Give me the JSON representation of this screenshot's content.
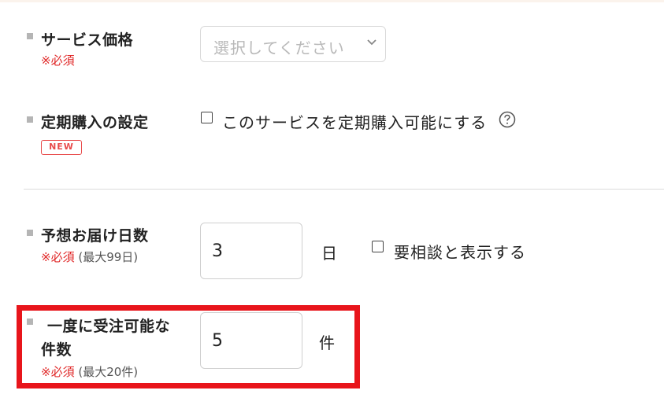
{
  "service_price": {
    "label": "サービス価格",
    "required": "※必須",
    "select_placeholder": "選択してください"
  },
  "subscription": {
    "label": "定期購入の設定",
    "badge": "NEW",
    "checkbox_label": "このサービスを定期購入可能にする"
  },
  "delivery_days": {
    "label": "予想お届け日数",
    "required": "※必須",
    "limit": "(最大99日)",
    "value": "3",
    "unit": "日",
    "checkbox_label": "要相談と表示する"
  },
  "orders_at_once": {
    "label_line1": "一度に受注可能な",
    "label_line2": "件数",
    "required": "※必須",
    "limit": "(最大20件)",
    "value": "5",
    "unit": "件"
  },
  "colors": {
    "required_red": "#e02828",
    "highlight_red": "#e8151b",
    "badge_red": "#e84a4a"
  }
}
